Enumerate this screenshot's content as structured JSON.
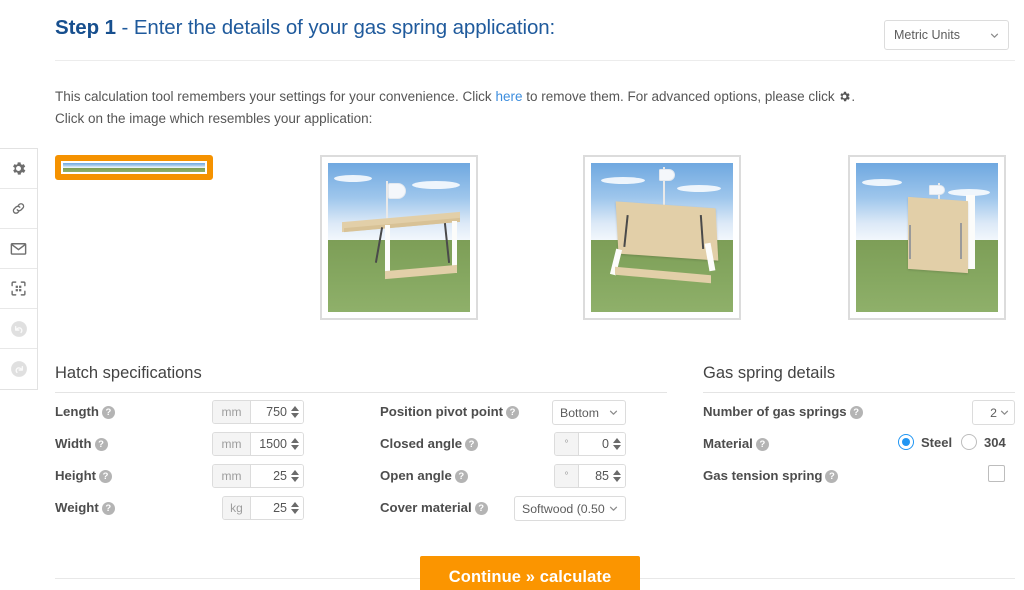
{
  "header": {
    "step_label": "Step 1",
    "title_rest": " - Enter the details of your gas spring application:",
    "units_value": "Metric Units",
    "units_icon": "chevron-down-icon"
  },
  "intro": {
    "text_before_link": "This calculation tool remembers your settings for your convenience. Click ",
    "link_text": "here",
    "text_after_link": " to remove them. For advanced options, please click ",
    "gear_icon": "gear-icon",
    "text_after_gear": ".",
    "second_line": "Click on the image which resembles your application:"
  },
  "sidebar": {
    "items": [
      {
        "name": "settings",
        "icon": "gear-icon",
        "disabled": false
      },
      {
        "name": "link",
        "icon": "chain-link-icon",
        "disabled": false
      },
      {
        "name": "email",
        "icon": "envelope-icon",
        "disabled": false
      },
      {
        "name": "scan",
        "icon": "qr-scan-icon",
        "disabled": false
      },
      {
        "name": "undo",
        "icon": "undo-arrow-icon",
        "disabled": true
      },
      {
        "name": "redo",
        "icon": "redo-arrow-icon",
        "disabled": true
      }
    ]
  },
  "applications": {
    "selected_index": 0,
    "items": [
      {
        "name": "hatch-lid-upward-box",
        "selected": true
      },
      {
        "name": "horizontal-flap-table",
        "selected": false
      },
      {
        "name": "angled-lid-frame",
        "selected": false
      },
      {
        "name": "vertical-door-panel",
        "selected": false
      }
    ]
  },
  "hatch": {
    "section_title": "Hatch specifications",
    "fields": [
      {
        "label": "Length",
        "unit": "mm",
        "value": "750",
        "help": "help-icon"
      },
      {
        "label": "Width",
        "unit": "mm",
        "value": "1500",
        "help": "help-icon"
      },
      {
        "label": "Height",
        "unit": "mm",
        "value": "25",
        "help": "help-icon"
      },
      {
        "label": "Weight",
        "unit": "kg",
        "value": "25",
        "help": "help-icon"
      }
    ]
  },
  "geometry": {
    "pivot_label": "Position pivot point",
    "pivot_value": "Bottom",
    "closed_label": "Closed angle",
    "closed_unit": "°",
    "closed_value": "0",
    "open_label": "Open angle",
    "open_unit": "°",
    "open_value": "85",
    "cover_label": "Cover material",
    "cover_value": "Softwood (0.50"
  },
  "gas_spring": {
    "section_title": "Gas spring details",
    "count_label": "Number of gas springs",
    "count_value": "2",
    "material_label": "Material",
    "material_option_1": "Steel",
    "material_option_2": "304",
    "material_selected": "Steel",
    "tension_label": "Gas tension spring",
    "tension_checked": false
  },
  "footer": {
    "cta_label": "Continue » calculate"
  },
  "colors": {
    "heading_blue": "#1f5a9c",
    "link_blue": "#3c8dde",
    "accent_orange": "#fb9500",
    "selected_border_orange": "#f59200",
    "radio_blue": "#2196f3"
  }
}
